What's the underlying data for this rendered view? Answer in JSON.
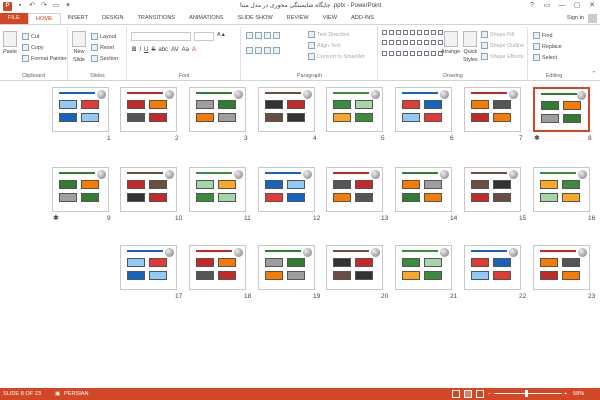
{
  "app": {
    "title": "جایگاه شایستگی محوری در مدل مبنا .pptx - PowerPoint",
    "accent": "#d24726",
    "qat_icons": [
      "save-icon",
      "undo-icon",
      "redo-icon",
      "start-from-beginning-icon",
      "customize-qat-icon"
    ],
    "window_controls": [
      "?",
      "▭",
      "—",
      "▢",
      "✕"
    ]
  },
  "tabs": [
    "FILE",
    "HOME",
    "INSERT",
    "DESIGN",
    "TRANSITIONS",
    "ANIMATIONS",
    "SLIDE SHOW",
    "REVIEW",
    "VIEW",
    "ADD-INS"
  ],
  "active_tab": "HOME",
  "account": {
    "signin": "Sign in"
  },
  "ribbon": {
    "clipboard": {
      "label": "Clipboard",
      "paste": "Paste",
      "cut": "Cut",
      "copy": "Copy",
      "format_painter": "Format Painter"
    },
    "slides": {
      "label": "Slides",
      "new_slide_1": "New",
      "new_slide_2": "Slide",
      "layout": "Layout",
      "reset": "Reset",
      "section": "Section"
    },
    "font": {
      "label": "Font",
      "bold": "B",
      "italic": "I",
      "underline": "U",
      "strike": "S",
      "shadow": "abc",
      "spacing": "AV",
      "case": "Aa",
      "color": "A"
    },
    "paragraph": {
      "label": "Paragraph",
      "text_direction": "Text Direction",
      "align_text": "Align Text",
      "smartart": "Convert to SmartArt"
    },
    "drawing": {
      "label": "Drawing",
      "arrange": "Arrange",
      "quick_styles_1": "Quick",
      "quick_styles_2": "Styles",
      "shape_fill": "Shape Fill",
      "shape_outline": "Shape Outline",
      "shape_effects": "Shape Effects"
    },
    "editing": {
      "label": "Editing",
      "find": "Find",
      "replace": "Replace",
      "select": "Select"
    }
  },
  "slides": [
    {
      "n": "8",
      "star": true,
      "selected": true
    },
    {
      "n": "7"
    },
    {
      "n": "6"
    },
    {
      "n": "5"
    },
    {
      "n": "4"
    },
    {
      "n": "3"
    },
    {
      "n": "2"
    },
    {
      "n": "1"
    },
    {
      "n": "16"
    },
    {
      "n": "15"
    },
    {
      "n": "14"
    },
    {
      "n": "13"
    },
    {
      "n": "12"
    },
    {
      "n": "11"
    },
    {
      "n": "10"
    },
    {
      "n": "9",
      "star": true
    },
    {
      "n": "23"
    },
    {
      "n": "22"
    },
    {
      "n": "21"
    },
    {
      "n": "20"
    },
    {
      "n": "19"
    },
    {
      "n": "18"
    },
    {
      "n": "17"
    }
  ],
  "status": {
    "slide_of": "SLIDE 8 OF 23",
    "language": "PERSIAN",
    "zoom": "58%",
    "zoom_minus": "−",
    "zoom_plus": "+"
  }
}
